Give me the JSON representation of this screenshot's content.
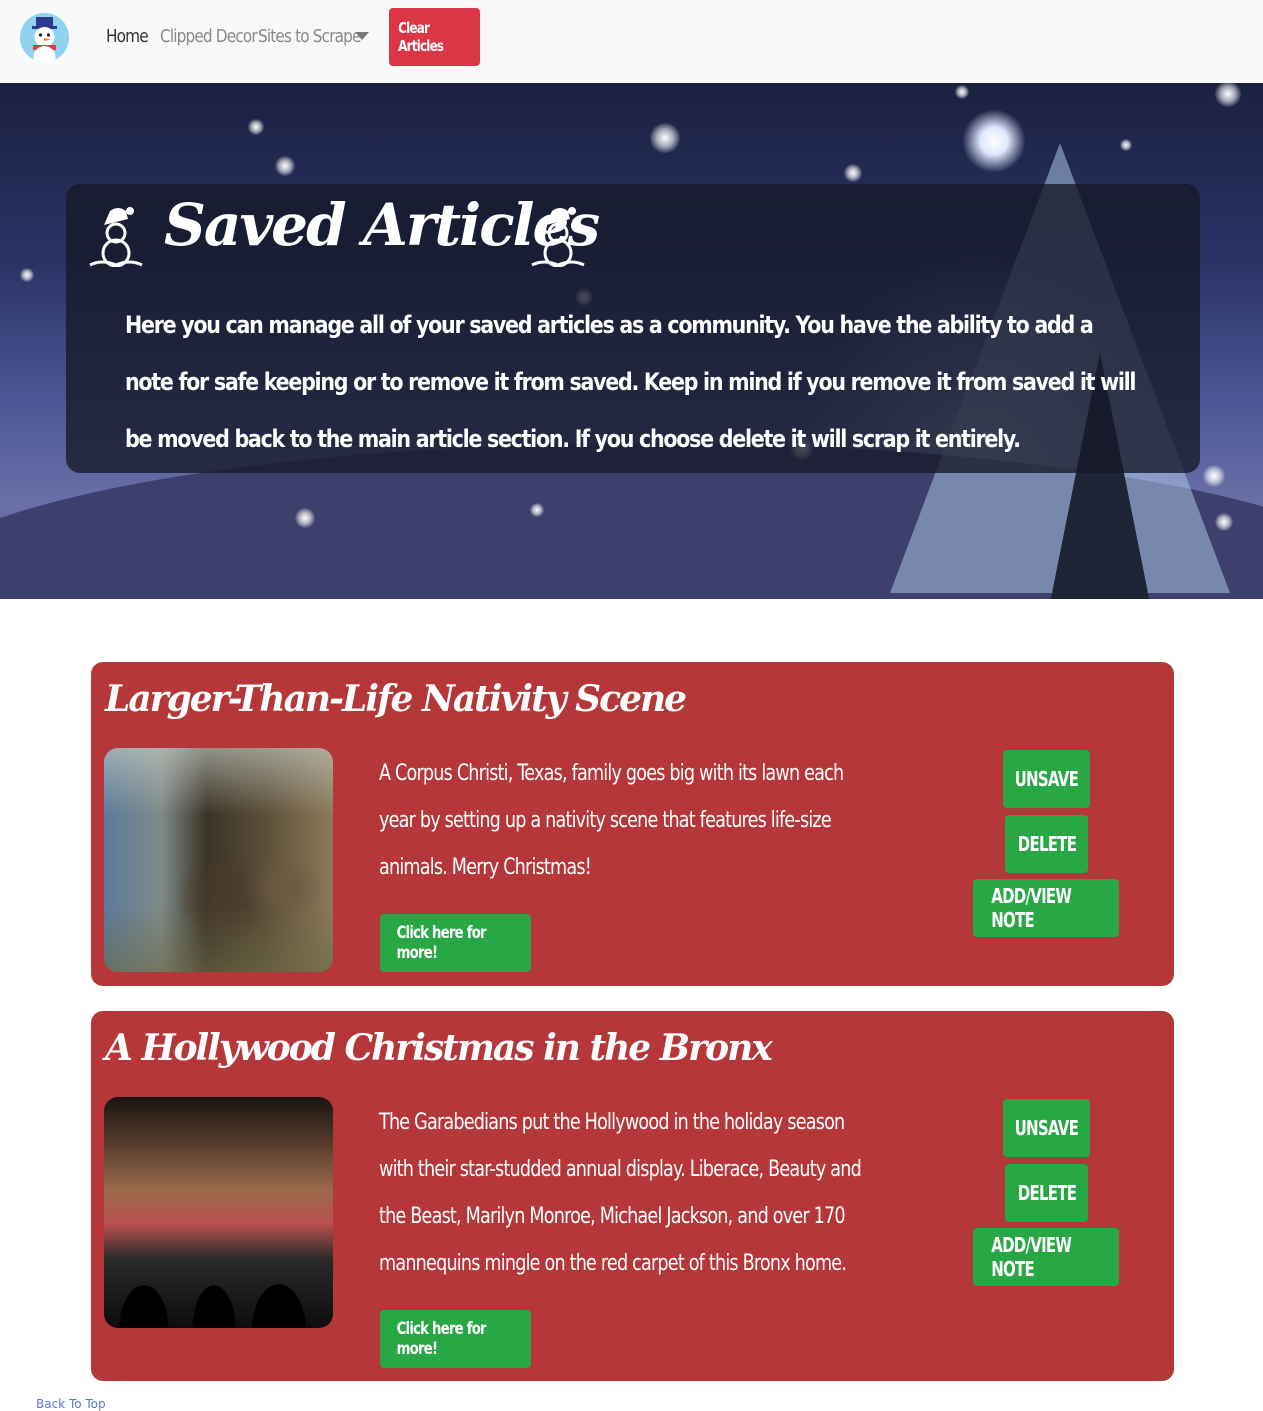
{
  "navbar": {
    "logo_icon": "snowman-icon",
    "links": [
      "Home",
      "Clipped Decor",
      "Sites to Scrape"
    ],
    "dropdown_icon": "caret-down-icon",
    "clear_button": "Clear Articles",
    "colors": {
      "navbar_bg": "#f8f9fa",
      "clear_button": "#dc3545"
    }
  },
  "hero": {
    "title": "Saved Articles",
    "title_icon": "snowman-icon",
    "description": "Here you can manage all of your saved articles as a community. You have the ability to add a note for safe keeping or to remove it from saved. Keep in mind if you remove it from saved it will be moved back to the main article section. If you choose delete it will scrap it entirely."
  },
  "articles": [
    {
      "title": "Larger-Than-Life Nativity Scene",
      "summary": "A Corpus Christi, Texas, family goes big with its lawn each year by setting up a nativity scene that features life-size animals. Merry Christmas!",
      "more_button": "Click here for more!",
      "unsave_button": "UNSAVE",
      "delete_button": "DELETE",
      "note_button": "ADD/VIEW NOTE"
    },
    {
      "title": "A Hollywood Christmas in the Bronx",
      "summary": "The Garabedians put the Hollywood in the holiday season with their star-studded annual display. Liberace, Beauty and the Beast, Marilyn Monroe, Michael Jackson, and over 170 mannequins mingle on the red carpet of this Bronx home.",
      "more_button": "Click here for more!",
      "unsave_button": "UNSAVE",
      "delete_button": "DELETE",
      "note_button": "ADD/VIEW NOTE"
    }
  ],
  "footer": {
    "text": "Back To Top"
  },
  "colors": {
    "card_bg": "#b5373a",
    "action_green": "#28a745"
  }
}
